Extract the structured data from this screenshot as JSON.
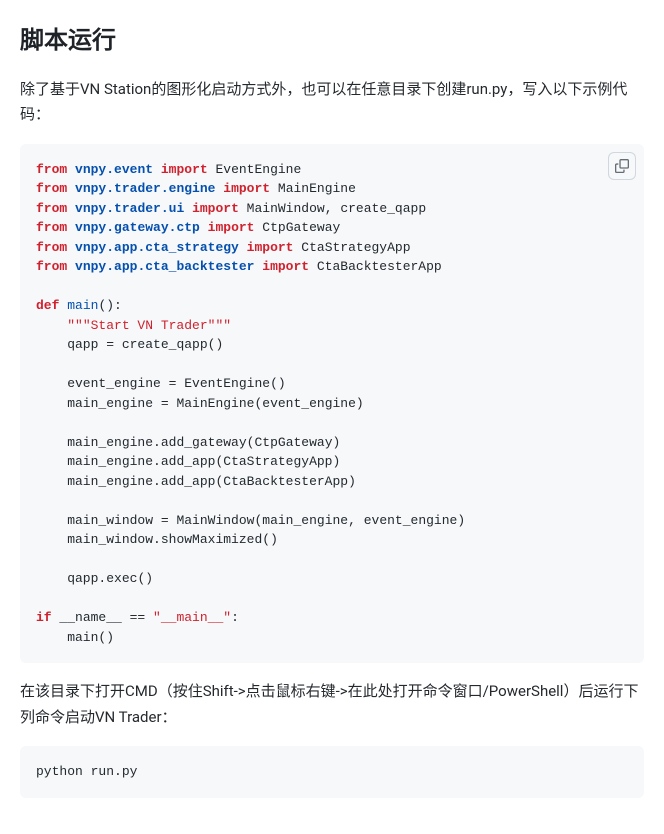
{
  "heading": "脚本运行",
  "intro": "除了基于VN Station的图形化启动方式外，也可以在任意目录下创建run.py，写入以下示例代码：",
  "code1": {
    "tokens": [
      {
        "t": "kw",
        "v": "from"
      },
      {
        "t": "pln",
        "v": " "
      },
      {
        "t": "nn",
        "v": "vnpy.event"
      },
      {
        "t": "pln",
        "v": " "
      },
      {
        "t": "kw",
        "v": "import"
      },
      {
        "t": "pln",
        "v": " EventEngine\n"
      },
      {
        "t": "kw",
        "v": "from"
      },
      {
        "t": "pln",
        "v": " "
      },
      {
        "t": "nn",
        "v": "vnpy.trader.engine"
      },
      {
        "t": "pln",
        "v": " "
      },
      {
        "t": "kw",
        "v": "import"
      },
      {
        "t": "pln",
        "v": " MainEngine\n"
      },
      {
        "t": "kw",
        "v": "from"
      },
      {
        "t": "pln",
        "v": " "
      },
      {
        "t": "nn",
        "v": "vnpy.trader.ui"
      },
      {
        "t": "pln",
        "v": " "
      },
      {
        "t": "kw",
        "v": "import"
      },
      {
        "t": "pln",
        "v": " MainWindow"
      },
      {
        "t": "p",
        "v": ","
      },
      {
        "t": "pln",
        "v": " create_qapp\n"
      },
      {
        "t": "kw",
        "v": "from"
      },
      {
        "t": "pln",
        "v": " "
      },
      {
        "t": "nn",
        "v": "vnpy.gateway.ctp"
      },
      {
        "t": "pln",
        "v": " "
      },
      {
        "t": "kw",
        "v": "import"
      },
      {
        "t": "pln",
        "v": " CtpGateway\n"
      },
      {
        "t": "kw",
        "v": "from"
      },
      {
        "t": "pln",
        "v": " "
      },
      {
        "t": "nn",
        "v": "vnpy.app.cta_strategy"
      },
      {
        "t": "pln",
        "v": " "
      },
      {
        "t": "kw",
        "v": "import"
      },
      {
        "t": "pln",
        "v": " CtaStrategyApp\n"
      },
      {
        "t": "kw",
        "v": "from"
      },
      {
        "t": "pln",
        "v": " "
      },
      {
        "t": "nn",
        "v": "vnpy.app.cta_backtester"
      },
      {
        "t": "pln",
        "v": " "
      },
      {
        "t": "kw",
        "v": "import"
      },
      {
        "t": "pln",
        "v": " CtaBacktesterApp\n\n"
      },
      {
        "t": "kw",
        "v": "def"
      },
      {
        "t": "pln",
        "v": " "
      },
      {
        "t": "fn",
        "v": "main"
      },
      {
        "t": "p",
        "v": "():"
      },
      {
        "t": "pln",
        "v": "\n    "
      },
      {
        "t": "str",
        "v": "\"\"\"Start VN Trader\"\"\""
      },
      {
        "t": "pln",
        "v": "\n    qapp "
      },
      {
        "t": "p",
        "v": "="
      },
      {
        "t": "pln",
        "v": " create_qapp"
      },
      {
        "t": "p",
        "v": "()"
      },
      {
        "t": "pln",
        "v": "\n\n    event_engine "
      },
      {
        "t": "p",
        "v": "="
      },
      {
        "t": "pln",
        "v": " EventEngine"
      },
      {
        "t": "p",
        "v": "()"
      },
      {
        "t": "pln",
        "v": "\n    main_engine "
      },
      {
        "t": "p",
        "v": "="
      },
      {
        "t": "pln",
        "v": " MainEngine"
      },
      {
        "t": "p",
        "v": "("
      },
      {
        "t": "pln",
        "v": "event_engine"
      },
      {
        "t": "p",
        "v": ")"
      },
      {
        "t": "pln",
        "v": "\n\n    main_engine"
      },
      {
        "t": "p",
        "v": "."
      },
      {
        "t": "pln",
        "v": "add_gateway"
      },
      {
        "t": "p",
        "v": "("
      },
      {
        "t": "pln",
        "v": "CtpGateway"
      },
      {
        "t": "p",
        "v": ")"
      },
      {
        "t": "pln",
        "v": "\n    main_engine"
      },
      {
        "t": "p",
        "v": "."
      },
      {
        "t": "pln",
        "v": "add_app"
      },
      {
        "t": "p",
        "v": "("
      },
      {
        "t": "pln",
        "v": "CtaStrategyApp"
      },
      {
        "t": "p",
        "v": ")"
      },
      {
        "t": "pln",
        "v": "\n    main_engine"
      },
      {
        "t": "p",
        "v": "."
      },
      {
        "t": "pln",
        "v": "add_app"
      },
      {
        "t": "p",
        "v": "("
      },
      {
        "t": "pln",
        "v": "CtaBacktesterApp"
      },
      {
        "t": "p",
        "v": ")"
      },
      {
        "t": "pln",
        "v": "\n\n    main_window "
      },
      {
        "t": "p",
        "v": "="
      },
      {
        "t": "pln",
        "v": " MainWindow"
      },
      {
        "t": "p",
        "v": "("
      },
      {
        "t": "pln",
        "v": "main_engine"
      },
      {
        "t": "p",
        "v": ","
      },
      {
        "t": "pln",
        "v": " event_engine"
      },
      {
        "t": "p",
        "v": ")"
      },
      {
        "t": "pln",
        "v": "\n    main_window"
      },
      {
        "t": "p",
        "v": "."
      },
      {
        "t": "pln",
        "v": "showMaximized"
      },
      {
        "t": "p",
        "v": "()"
      },
      {
        "t": "pln",
        "v": "\n\n    qapp"
      },
      {
        "t": "p",
        "v": "."
      },
      {
        "t": "pln",
        "v": "exec"
      },
      {
        "t": "p",
        "v": "()"
      },
      {
        "t": "pln",
        "v": "\n\n"
      },
      {
        "t": "kw",
        "v": "if"
      },
      {
        "t": "pln",
        "v": " __name__ "
      },
      {
        "t": "p",
        "v": "=="
      },
      {
        "t": "pln",
        "v": " "
      },
      {
        "t": "str",
        "v": "\"__main__\""
      },
      {
        "t": "p",
        "v": ":"
      },
      {
        "t": "pln",
        "v": "\n    main"
      },
      {
        "t": "p",
        "v": "()"
      }
    ]
  },
  "para2": "在该目录下打开CMD（按住Shift->点击鼠标右键->在此处打开命令窗口/PowerShell）后运行下列命令启动VN Trader：",
  "code2": "python run.py"
}
